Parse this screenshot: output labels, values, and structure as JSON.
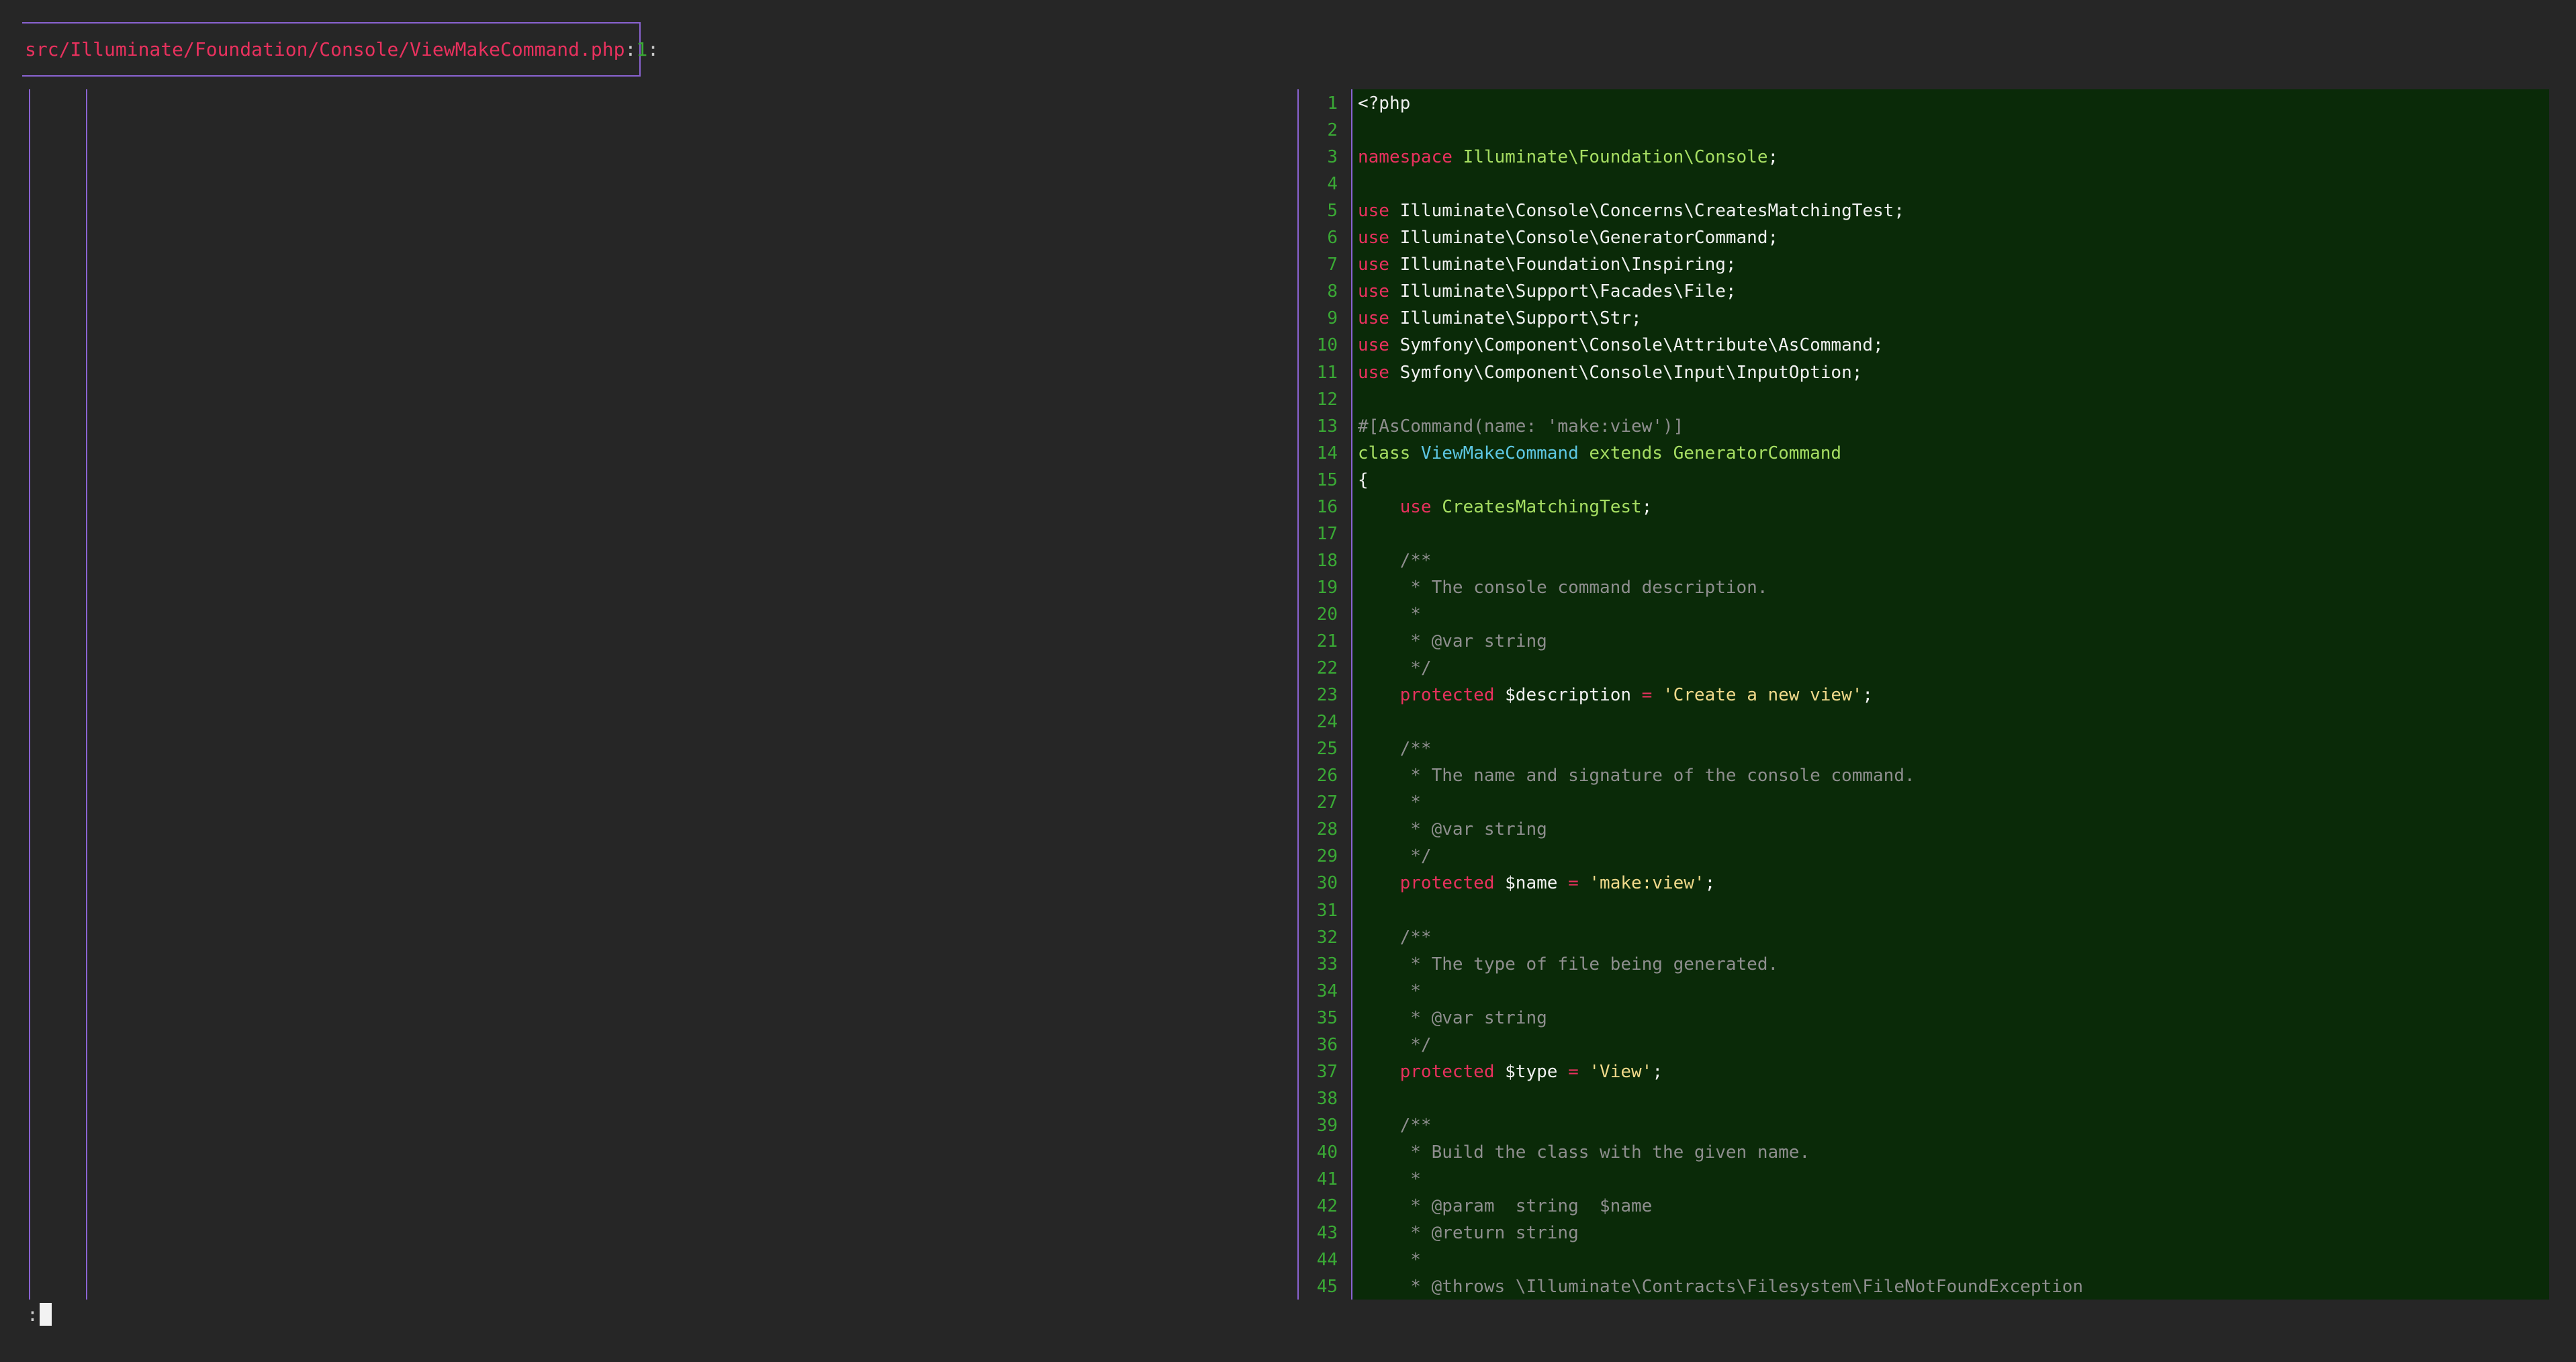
{
  "header": {
    "path": "src/Illuminate/Foundation/Console/ViewMakeCommand.php",
    "sep1": ":",
    "line": "1",
    "sep2": ":"
  },
  "prompt": {
    "char": ":"
  },
  "code_lines": [
    [
      {
        "t": "<?php",
        "c": "var"
      }
    ],
    [],
    [
      {
        "t": "namespace ",
        "c": "kw"
      },
      {
        "t": "Illuminate\\Foundation\\Console",
        "c": "ns"
      },
      {
        "t": ";",
        "c": "var"
      }
    ],
    [],
    [
      {
        "t": "use ",
        "c": "kw"
      },
      {
        "t": "Illuminate\\Console\\Concerns\\CreatesMatchingTest;",
        "c": "var"
      }
    ],
    [
      {
        "t": "use ",
        "c": "kw"
      },
      {
        "t": "Illuminate\\Console\\GeneratorCommand;",
        "c": "var"
      }
    ],
    [
      {
        "t": "use ",
        "c": "kw"
      },
      {
        "t": "Illuminate\\Foundation\\Inspiring;",
        "c": "var"
      }
    ],
    [
      {
        "t": "use ",
        "c": "kw"
      },
      {
        "t": "Illuminate\\Support\\Facades\\File;",
        "c": "var"
      }
    ],
    [
      {
        "t": "use ",
        "c": "kw"
      },
      {
        "t": "Illuminate\\Support\\Str;",
        "c": "var"
      }
    ],
    [
      {
        "t": "use ",
        "c": "kw"
      },
      {
        "t": "Symfony\\Component\\Console\\Attribute\\AsCommand;",
        "c": "var"
      }
    ],
    [
      {
        "t": "use ",
        "c": "kw"
      },
      {
        "t": "Symfony\\Component\\Console\\Input\\InputOption;",
        "c": "var"
      }
    ],
    [],
    [
      {
        "t": "#[AsCommand(name: 'make:view')]",
        "c": "cm"
      }
    ],
    [
      {
        "t": "class ",
        "c": "ext"
      },
      {
        "t": "ViewMakeCommand",
        "c": "cls"
      },
      {
        "t": " extends ",
        "c": "ext"
      },
      {
        "t": "GeneratorCommand",
        "c": "ext"
      }
    ],
    [
      {
        "t": "{",
        "c": "var"
      }
    ],
    [
      {
        "t": "    use ",
        "c": "kw"
      },
      {
        "t": "CreatesMatchingTest",
        "c": "ns"
      },
      {
        "t": ";",
        "c": "var"
      }
    ],
    [],
    [
      {
        "t": "    /**",
        "c": "cm"
      }
    ],
    [
      {
        "t": "     * The console command description.",
        "c": "cm"
      }
    ],
    [
      {
        "t": "     *",
        "c": "cm"
      }
    ],
    [
      {
        "t": "     * @var string",
        "c": "cm"
      }
    ],
    [
      {
        "t": "     */",
        "c": "cm"
      }
    ],
    [
      {
        "t": "    protected ",
        "c": "kw"
      },
      {
        "t": "$description ",
        "c": "var"
      },
      {
        "t": "= ",
        "c": "kw"
      },
      {
        "t": "'Create a new view'",
        "c": "str"
      },
      {
        "t": ";",
        "c": "var"
      }
    ],
    [],
    [
      {
        "t": "    /**",
        "c": "cm"
      }
    ],
    [
      {
        "t": "     * The name and signature of the console command.",
        "c": "cm"
      }
    ],
    [
      {
        "t": "     *",
        "c": "cm"
      }
    ],
    [
      {
        "t": "     * @var string",
        "c": "cm"
      }
    ],
    [
      {
        "t": "     */",
        "c": "cm"
      }
    ],
    [
      {
        "t": "    protected ",
        "c": "kw"
      },
      {
        "t": "$name ",
        "c": "var"
      },
      {
        "t": "= ",
        "c": "kw"
      },
      {
        "t": "'make:view'",
        "c": "str"
      },
      {
        "t": ";",
        "c": "var"
      }
    ],
    [],
    [
      {
        "t": "    /**",
        "c": "cm"
      }
    ],
    [
      {
        "t": "     * The type of file being generated.",
        "c": "cm"
      }
    ],
    [
      {
        "t": "     *",
        "c": "cm"
      }
    ],
    [
      {
        "t": "     * @var string",
        "c": "cm"
      }
    ],
    [
      {
        "t": "     */",
        "c": "cm"
      }
    ],
    [
      {
        "t": "    protected ",
        "c": "kw"
      },
      {
        "t": "$type ",
        "c": "var"
      },
      {
        "t": "= ",
        "c": "kw"
      },
      {
        "t": "'View'",
        "c": "str"
      },
      {
        "t": ";",
        "c": "var"
      }
    ],
    [],
    [
      {
        "t": "    /**",
        "c": "cm"
      }
    ],
    [
      {
        "t": "     * Build the class with the given name.",
        "c": "cm"
      }
    ],
    [
      {
        "t": "     *",
        "c": "cm"
      }
    ],
    [
      {
        "t": "     * @param  string  $name",
        "c": "cm"
      }
    ],
    [
      {
        "t": "     * @return string",
        "c": "cm"
      }
    ],
    [
      {
        "t": "     *",
        "c": "cm"
      }
    ],
    [
      {
        "t": "     * @throws \\Illuminate\\Contracts\\Filesystem\\FileNotFoundException",
        "c": "cm"
      }
    ]
  ]
}
